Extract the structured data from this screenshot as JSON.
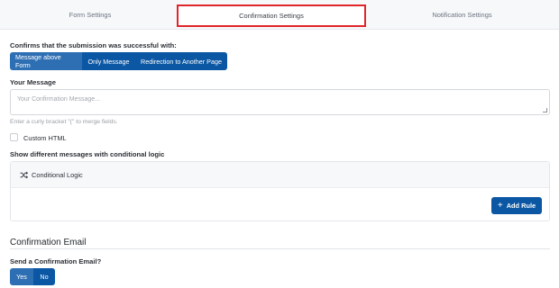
{
  "tabs": [
    {
      "label": "Form Settings"
    },
    {
      "label": "Confirmation Settings"
    },
    {
      "label": "Notification Settings"
    }
  ],
  "confirm": {
    "question": "Confirms that the submission was successful with:",
    "options": [
      "Message above Form",
      "Only Message",
      "Redirection to Another Page"
    ],
    "selected": "Message above Form"
  },
  "message": {
    "label": "Your Message",
    "placeholder": "Your Confirmation Message...",
    "hint": "Enter a curly bracket \"{\" to merge fields."
  },
  "custom_html": {
    "label": "Custom HTML",
    "checked": false
  },
  "conditional": {
    "label": "Show different messages with conditional logic",
    "row_label": "Conditional Logic",
    "row_icon": "shuffle-icon",
    "add_rule_label": "Add Rule",
    "add_rule_icon": "plus-icon"
  },
  "email": {
    "section_title": "Confirmation Email",
    "question": "Send a Confirmation Email?",
    "yes_label": "Yes",
    "no_label": "No",
    "selected": "Yes"
  },
  "colors": {
    "primary": "#0b57a4",
    "primary_active": "#2e6fb3",
    "highlight_border": "#e0262a"
  }
}
